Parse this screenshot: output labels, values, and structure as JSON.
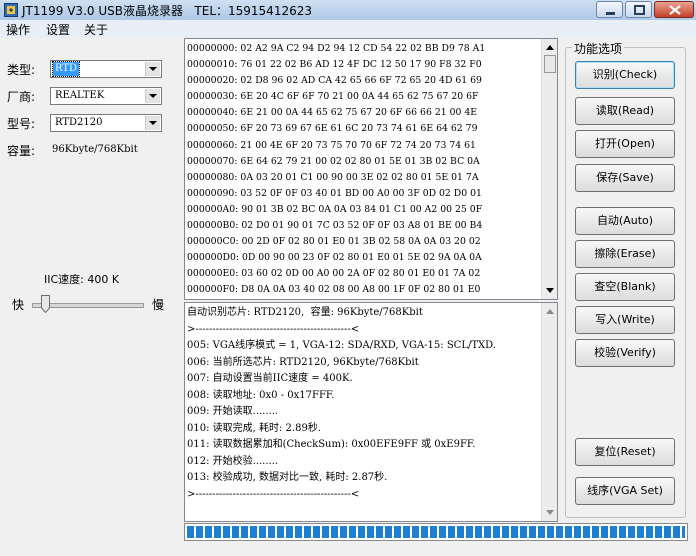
{
  "window": {
    "title": "JT1199 V3.0 USB液晶烧录器   TEL：15915412623",
    "controls": [
      "minimize-icon",
      "maximize-icon",
      "close-icon"
    ]
  },
  "menu": [
    "操作",
    "设置",
    "关于"
  ],
  "left_panel": {
    "type_label": "类型:",
    "type_value": "RTD",
    "vendor_label": "厂商:",
    "vendor_value": "REALTEK",
    "model_label": "型号:",
    "model_value": "RTD2120",
    "capacity_label": "容量:",
    "capacity_value": "96Kbyte/768Kbit",
    "iic_speed": "IIC速度: 400 K",
    "slider_fast": "快",
    "slider_slow": "慢",
    "slider_level": 0.1
  },
  "hex_dump": [
    "00000000: 02 A2 9A C2 94 D2 94 12 CD 54 22 02 BB D9 78 A1",
    "00000010: 76 01 22 02 B6 AD 12 4F DC 12 50 17 90 F8 32 F0",
    "00000020: 02 D8 96 02 AD CA 42 65 66 6F 72 65 20 4D 61 69",
    "00000030: 6E 20 4C 6F 6F 70 21 00 0A 44 65 62 75 67 20 6F",
    "00000040: 6E 21 00 0A 44 65 62 75 67 20 6F 66 66 21 00 4E",
    "00000050: 6F 20 73 69 67 6E 61 6C 20 73 74 61 6E 64 62 79",
    "00000060: 21 00 4E 6F 20 73 75 70 70 6F 72 74 20 73 74 61",
    "00000070: 6E 64 62 79 21 00 02 02 80 01 5E 01 3B 02 BC 0A",
    "00000080: 0A 03 20 01 C1 00 90 00 3E 02 02 80 01 5E 01 7A",
    "00000090: 03 52 0F 0F 03 40 01 BD 00 A0 00 3F 0D 02 D0 01",
    "000000A0: 90 01 3B 02 BC 0A 0A 03 84 01 C1 00 A2 00 25 0F",
    "000000B0: 02 D0 01 90 01 7C 03 52 0F 0F 03 A8 01 BE 00 B4",
    "000000C0: 00 2D 0F 02 80 01 E0 01 3B 02 58 0A 0A 03 20 02",
    "000000D0: 0D 00 90 00 23 0F 02 80 01 E0 01 5E 02 9A 0A 0A",
    "000000E0: 03 60 02 0D 00 A0 00 2A 0F 02 80 01 E0 01 7A 02",
    "000000F0: D8 0A 0A 03 40 02 08 00 A8 00 1F 0F 02 80 01 E0"
  ],
  "log": [
    "自动识别芯片: RTD2120,  容量: 96Kbyte/768Kbit",
    ">----------------------------------------------<",
    "005: VGA线序模式 = 1, VGA-12: SDA/RXD, VGA-15: SCL/TXD.",
    "006: 当前所选芯片: RTD2120, 96Kbyte/768Kbit",
    "007: 自动设置当前IIC速度 = 400K.",
    "008: 读取地址: 0x0 - 0x17FFF.",
    "009: 开始读取........",
    "010: 读取完成, 耗时: 2.89秒.",
    "011: 读取数据累加和(CheckSum): 0x00EFE9FF 或 0xE9FF.",
    "012: 开始校验........",
    "013: 校验成功, 数据对比一致, 耗时: 2.87秒.",
    ">----------------------------------------------<"
  ],
  "progress": 1.0,
  "functions": {
    "legend": "功能选项",
    "check": "识别(Check)",
    "read": "读取(Read)",
    "open": "打开(Open)",
    "save": "保存(Save)",
    "auto": "自动(Auto)",
    "erase": "擦除(Erase)",
    "blank": "查空(Blank)",
    "write": "写入(Write)",
    "verify": "校验(Verify)",
    "reset": "复位(Reset)",
    "vga_set": "线序(VGA Set)"
  }
}
